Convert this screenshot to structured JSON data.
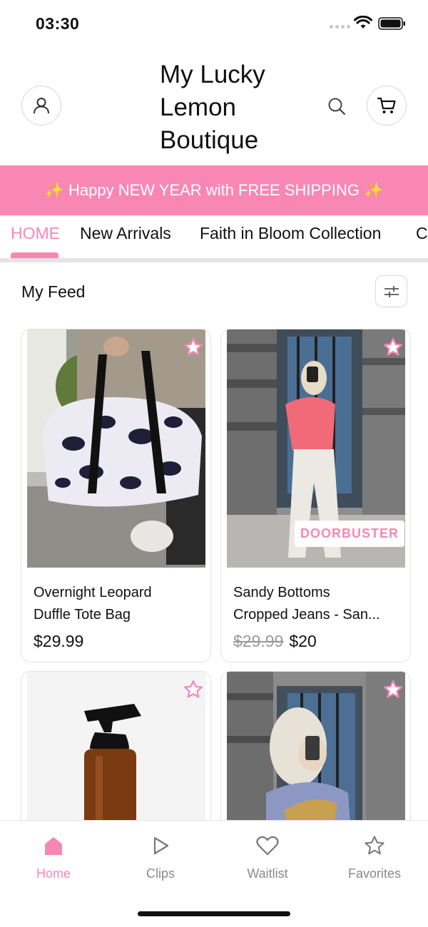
{
  "status_bar": {
    "time": "03:30"
  },
  "header": {
    "brand_line1": "My Lucky",
    "brand_line2": "Lemon",
    "brand_line3": "Boutique",
    "account_icon": "user-icon",
    "search_icon": "search-icon",
    "cart_icon": "cart-icon"
  },
  "promo": {
    "text": "✨ Happy NEW YEAR with FREE SHIPPING ✨"
  },
  "tabs": [
    {
      "label": "HOME",
      "active": true
    },
    {
      "label": "New Arrivals"
    },
    {
      "label": "Faith in Bloom Collection"
    },
    {
      "label": "C"
    }
  ],
  "feed": {
    "title": "My Feed",
    "filter_icon": "sliders-icon"
  },
  "products": [
    {
      "name_line1": "Overnight Leopard",
      "name_line2": "Duffle Tote Bag",
      "price": "$29.99"
    },
    {
      "name_line1": "Sandy Bottoms",
      "name_line2": "Cropped Jeans - San...",
      "old_price": "$29.99",
      "price": "$20",
      "badge": "DOORBUSTER"
    },
    {
      "name_line1": "",
      "name_line2": "",
      "price": ""
    },
    {
      "name_line1": "",
      "name_line2": "",
      "price": ""
    }
  ],
  "bottom_nav": [
    {
      "label": "Home",
      "icon": "home-icon",
      "active": true
    },
    {
      "label": "Clips",
      "icon": "play-icon"
    },
    {
      "label": "Waitlist",
      "icon": "heart-icon"
    },
    {
      "label": "Favorites",
      "icon": "star-icon"
    }
  ],
  "colors": {
    "accent": "#f887b4",
    "text": "#111111",
    "muted": "#8a8a8a"
  }
}
